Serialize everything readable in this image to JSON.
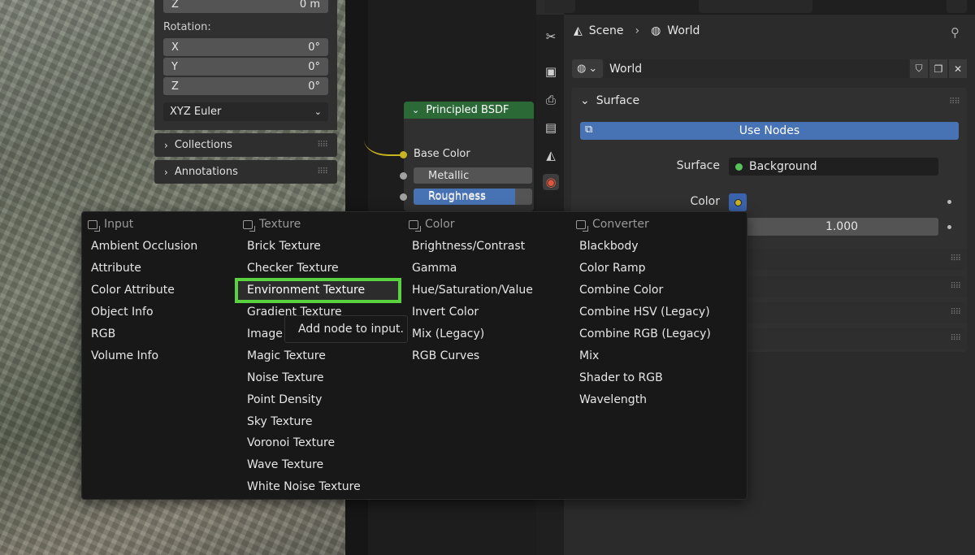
{
  "viewport": {
    "z_top_label": "Z",
    "z_top_value": "0 m",
    "rotation_label": "Rotation:",
    "rotation": [
      {
        "axis": "X",
        "value": "0°"
      },
      {
        "axis": "Y",
        "value": "0°"
      },
      {
        "axis": "Z",
        "value": "0°"
      }
    ],
    "rotation_mode": "XYZ Euler",
    "collections_label": "Collections",
    "annotations_label": "Annotations"
  },
  "node": {
    "title": "Principled BSDF",
    "base_color_label": "Base Color",
    "metallic_label": "Metallic",
    "roughness_label": "Roughness"
  },
  "properties": {
    "breadcrumb_scene": "Scene",
    "breadcrumb_world": "World",
    "world_name": "World",
    "surface_title": "Surface",
    "use_nodes_label": "Use Nodes",
    "surface_label": "Surface",
    "surface_value": "Background",
    "color_label": "Color",
    "strength_value": "1.000"
  },
  "menu": {
    "columns": [
      {
        "header": "Input",
        "items": [
          "Ambient Occlusion",
          "Attribute",
          "Color Attribute",
          "Object Info",
          "RGB",
          "Volume Info"
        ]
      },
      {
        "header": "Texture",
        "items": [
          "Brick Texture",
          "Checker Texture",
          "Environment Texture",
          "Gradient Texture",
          "Image Texture",
          "Magic Texture",
          "Noise Texture",
          "Point Density",
          "Sky Texture",
          "Voronoi Texture",
          "Wave Texture",
          "White Noise Texture"
        ]
      },
      {
        "header": "Color",
        "items": [
          "Brightness/Contrast",
          "Gamma",
          "Hue/Saturation/Value",
          "Invert Color",
          "Mix (Legacy)",
          "RGB Curves"
        ]
      },
      {
        "header": "Converter",
        "items": [
          "Blackbody",
          "Color Ramp",
          "Combine Color",
          "Combine HSV (Legacy)",
          "Combine RGB (Legacy)",
          "Mix",
          "Shader to RGB",
          "Wavelength"
        ]
      }
    ],
    "tooltip": "Add node to input."
  },
  "colors": {
    "accent_blue": "#4772b3",
    "node_header_green": "#2b6a37",
    "highlight_green": "#5ad13f",
    "socket_yellow": "#c9b321"
  }
}
